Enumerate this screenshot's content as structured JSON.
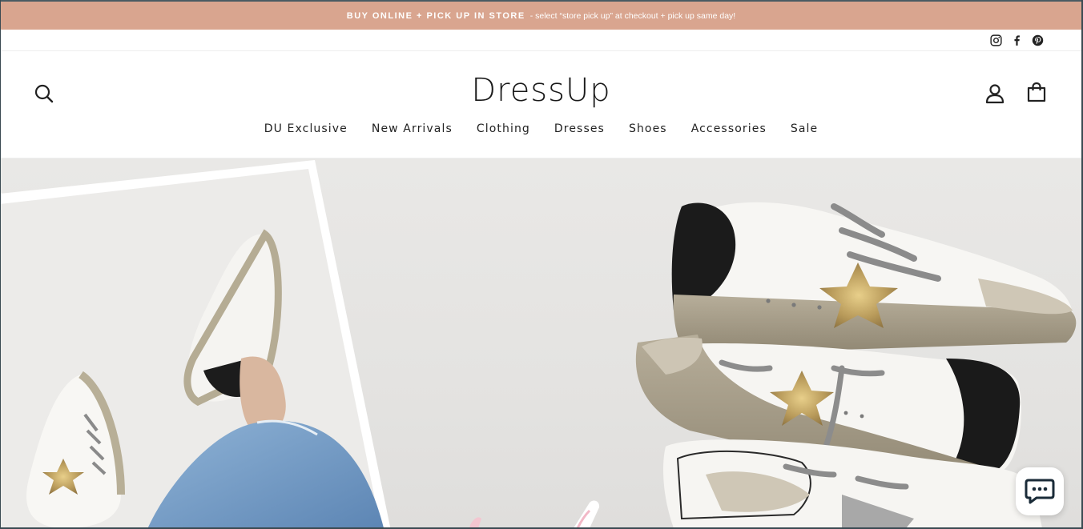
{
  "announcement": {
    "strong": "BUY ONLINE + PICK UP IN STORE",
    "detail": "- select “store pick up” at checkout + pick up same day!"
  },
  "social": {
    "icons": [
      "instagram-icon",
      "facebook-icon",
      "pinterest-icon"
    ]
  },
  "header": {
    "logo": "DressUp",
    "icons": {
      "search": "search-icon",
      "account": "user-icon",
      "cart": "shopping-bag-icon"
    }
  },
  "nav": {
    "items": [
      {
        "label": "DU Exclusive"
      },
      {
        "label": "New Arrivals"
      },
      {
        "label": "Clothing"
      },
      {
        "label": "Dresses"
      },
      {
        "label": "Shoes"
      },
      {
        "label": "Accessories"
      },
      {
        "label": "Sale"
      }
    ]
  },
  "hero": {
    "image": "sneakers-hero-image"
  },
  "chat": {
    "icon": "chat-bubble-icon"
  },
  "colors": {
    "announcement_bg": "#d9a58f",
    "text": "#222222",
    "hero_bg": "#e6e5e3"
  }
}
